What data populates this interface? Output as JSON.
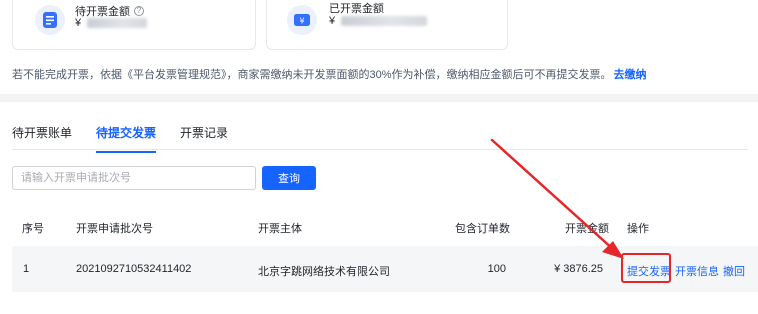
{
  "summary": {
    "pending_label": "待开票金额",
    "pending_currency": "¥",
    "issued_label": "已开票金额",
    "issued_currency": "¥"
  },
  "notice": {
    "text": "若不能完成开票，依据《平台发票管理规范》，商家需缴纳未开发票面额的30%作为补偿，缴纳相应金额后可不再提交发票。",
    "link": "去缴纳"
  },
  "tabs": [
    {
      "label": "待开票账单",
      "active": false
    },
    {
      "label": "待提交发票",
      "active": true
    },
    {
      "label": "开票记录",
      "active": false
    }
  ],
  "search": {
    "placeholder": "请输入开票申请批次号",
    "value": "",
    "button_label": "查询"
  },
  "table": {
    "headers": [
      "序号",
      "开票申请批次号",
      "开票主体",
      "包含订单数",
      "开票金额",
      "操作"
    ],
    "rows": [
      {
        "index": "1",
        "batch_no": "2021092710532411402",
        "entity": "北京字跳网络技术有限公司",
        "order_count": "100",
        "amount": "¥ 3876.25",
        "actions": [
          "提交发票",
          "开票信息",
          "撤回"
        ]
      }
    ]
  },
  "colors": {
    "accent": "#1664ff",
    "annotation": "#e6262b"
  },
  "icons": {
    "pending": "invoice-document-icon",
    "issued": "yuan-bill-icon",
    "help": "question-circle-icon"
  }
}
